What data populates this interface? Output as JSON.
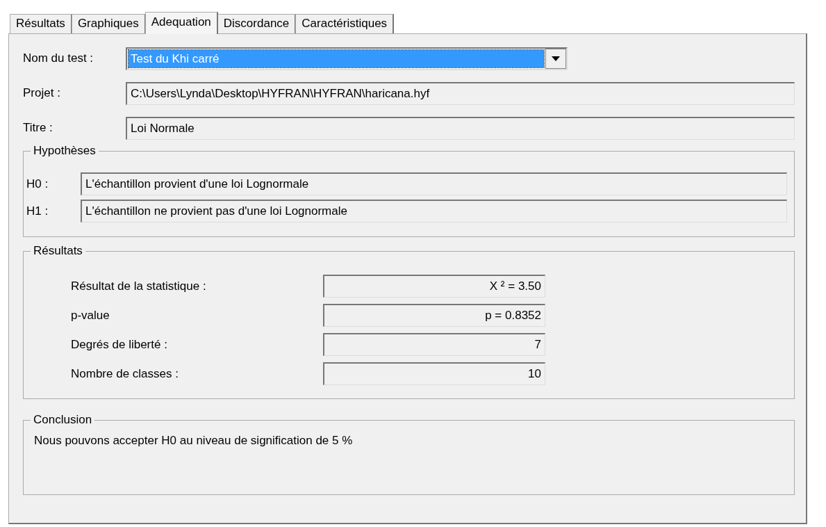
{
  "tabs": [
    {
      "label": "Résultats",
      "selected": false
    },
    {
      "label": "Graphiques",
      "selected": false
    },
    {
      "label": "Adequation",
      "selected": true
    },
    {
      "label": "Discordance",
      "selected": false
    },
    {
      "label": "Caractéristiques",
      "selected": false
    }
  ],
  "test_name": {
    "label": "Nom du test :",
    "value": "Test du Khi carré"
  },
  "project": {
    "label": "Projet :",
    "value": "C:\\Users\\Lynda\\Desktop\\HYFRAN\\HYFRAN\\haricana.hyf"
  },
  "title": {
    "label": "Titre :",
    "value": "Loi Normale"
  },
  "hypotheses": {
    "legend": "Hypothèses",
    "items": [
      {
        "label": "H0 :",
        "value": "L'échantillon provient d'une loi Lognormale"
      },
      {
        "label": "H1 :",
        "value": "L'échantillon ne provient pas d'une loi Lognormale"
      }
    ]
  },
  "results": {
    "legend": "Résultats",
    "items": [
      {
        "label": "Résultat de la statistique :",
        "value": "X ² = 3.50"
      },
      {
        "label": "p-value",
        "value": "p = 0.8352"
      },
      {
        "label": "Degrés de liberté :",
        "value": "7"
      },
      {
        "label": "Nombre de classes :",
        "value": "10"
      }
    ]
  },
  "conclusion": {
    "legend": "Conclusion",
    "text": "Nous pouvons accepter H0 au niveau de signification de 5 %"
  }
}
